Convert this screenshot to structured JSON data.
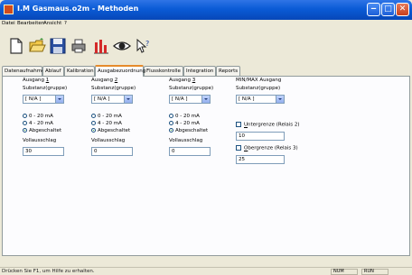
{
  "window": {
    "title": "I.M Gasmaus.o2m - Methoden"
  },
  "menubar": {
    "items": [
      "Datei",
      "Bearbeiten",
      "Ansicht",
      "?"
    ]
  },
  "toolbar": {
    "tools": [
      "new-file-icon",
      "open-folder-icon",
      "save-disk-icon",
      "print-icon",
      "chart-bars-icon",
      "eye-icon",
      "help-pointer-icon"
    ]
  },
  "tabs": [
    {
      "label": "Datenaufnahme",
      "active": false
    },
    {
      "label": "Ablauf",
      "active": false
    },
    {
      "label": "Kalibration",
      "active": false
    },
    {
      "label": "Ausgabezuordnung",
      "active": true
    },
    {
      "label": "Flusskontrolle",
      "active": false
    },
    {
      "label": "Integration",
      "active": false
    },
    {
      "label": "Reports",
      "active": false
    }
  ],
  "groups": [
    {
      "title_prefix": "Ausgang ",
      "title_num": "1",
      "subtitle": "Substanz(gruppe)",
      "select_value": "[ N/A ]",
      "radios": [
        "0 - 20 mA",
        "4 - 20 mA",
        "Abgeschaltet"
      ],
      "selected_radio": 2,
      "range_label": "Vollausschlag",
      "range_value": "30"
    },
    {
      "title_prefix": "Ausgang ",
      "title_num": "2",
      "subtitle": "Substanz(gruppe)",
      "select_value": "[ N/A ]",
      "radios": [
        "0 - 20 mA",
        "4 - 20 mA",
        "Abgeschaltet"
      ],
      "selected_radio": 2,
      "range_label": "Vollausschlag",
      "range_value": "0"
    },
    {
      "title_prefix": "Ausgang ",
      "title_num": "3",
      "subtitle": "Substanz(gruppe)",
      "select_value": "[ N/A ]",
      "radios": [
        "0 - 20 mA",
        "4 - 20 mA",
        "Abgeschaltet"
      ],
      "selected_radio": 2,
      "range_label": "Vollausschlag",
      "range_value": "0"
    }
  ],
  "minmax": {
    "title": "MIN/MAX Ausgang",
    "subtitle": "Substanz(gruppe)",
    "select_value": "[ N/A ]",
    "lower_label_u": "U",
    "lower_label_rest": "ntergrenze (Relais 2)",
    "lower_value": "10",
    "upper_label_u": "O",
    "upper_label_rest": "bergrenze (Relais 3)",
    "upper_value": "25"
  },
  "statusbar": {
    "text": "Drücken Sie F1, um Hilfe zu erhalten.",
    "pane1": "NUM  ",
    "pane2": "RUN  "
  }
}
